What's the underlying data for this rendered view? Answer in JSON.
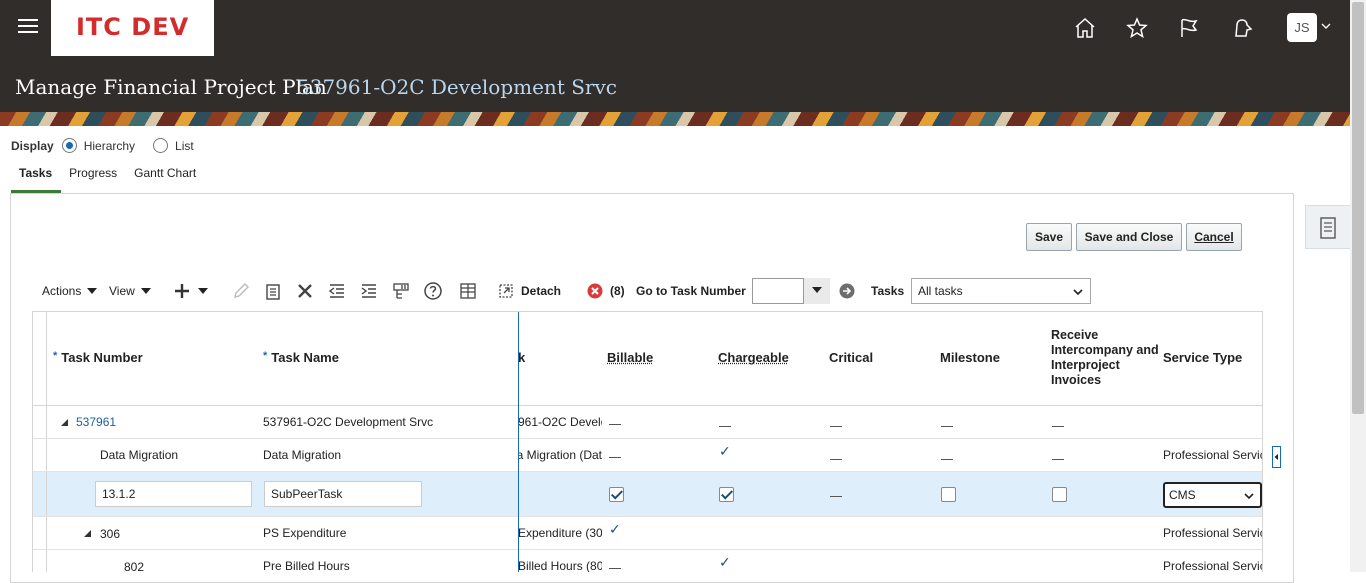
{
  "header": {
    "logo_text": "ITC DEV",
    "icons": [
      "home-icon",
      "star-icon",
      "flag-icon",
      "notifications-icon"
    ],
    "user_initials": "JS"
  },
  "page": {
    "title": "Manage Financial Project Plan",
    "subtitle": "537961-O2C Development Srvc"
  },
  "display": {
    "label": "Display",
    "options": [
      "Hierarchy",
      "List"
    ],
    "selected": "Hierarchy"
  },
  "tabs": [
    "Tasks",
    "Progress",
    "Gantt Chart"
  ],
  "buttons": {
    "save": "Save",
    "save_close": "Save and Close",
    "cancel": "Cancel"
  },
  "toolbar": {
    "actions": "Actions",
    "view": "View",
    "detach": "Detach",
    "error_count": "(8)",
    "goto_label": "Go to Task Number",
    "tasks_label": "Tasks",
    "tasks_filter": "All tasks"
  },
  "table": {
    "columns": {
      "task_number": "Task Number",
      "task_name": "Task Name",
      "frozen_partial": "k",
      "billable": "Billable",
      "chargeable": "Chargeable",
      "critical": "Critical",
      "milestone": "Milestone",
      "receive_invoices": "Receive Intercompany and Interproject Invoices",
      "service_type": "Service Type"
    },
    "rows": [
      {
        "number": "537961",
        "name": "537961-O2C Development Srvc",
        "frozen": "961-O2C Develo",
        "service": ""
      },
      {
        "number": "Data Migration",
        "name": "Data Migration",
        "frozen": "a Migration (Dat",
        "service": "Professional Servic"
      },
      {
        "number": "13.1.2",
        "name": "SubPeerTask",
        "frozen": "",
        "service": "CMS"
      },
      {
        "number": "306",
        "name": "PS Expenditure",
        "frozen": "Expenditure (30",
        "service": "Professional Servic"
      },
      {
        "number": "802",
        "name": "Pre Billed Hours",
        "frozen": "Billed Hours (80",
        "service": "Professional Servic"
      }
    ]
  }
}
